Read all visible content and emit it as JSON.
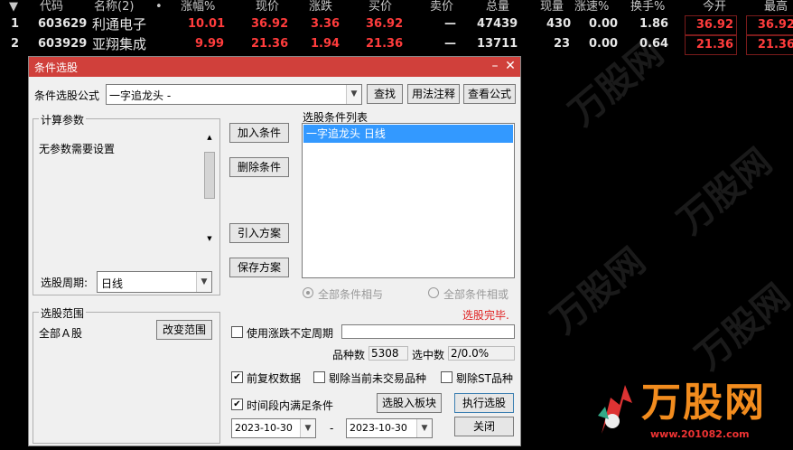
{
  "table": {
    "headers": [
      "代码",
      "名称(2)",
      "•",
      "涨幅%",
      "现价",
      "涨跌",
      "买价",
      "卖价",
      "总量",
      "现量",
      "涨速%",
      "换手%",
      "今开",
      "最高"
    ],
    "rows": [
      {
        "idx": "1",
        "code": "603629",
        "name": "利通电子",
        "change_pct": "10.01",
        "price": "36.92",
        "change": "3.36",
        "bid": "36.92",
        "ask": "—",
        "volume": "47439",
        "cur_vol": "430",
        "speed": "0.00",
        "turnover": "1.86",
        "open": "36.92",
        "high": "36.92"
      },
      {
        "idx": "2",
        "code": "603929",
        "name": "亚翔集成",
        "change_pct": "9.99",
        "price": "21.36",
        "change": "1.94",
        "bid": "21.36",
        "ask": "—",
        "volume": "13711",
        "cur_vol": "23",
        "speed": "0.00",
        "turnover": "0.64",
        "open": "21.36",
        "high": "21.36"
      }
    ]
  },
  "dialog": {
    "title": "条件选股",
    "formula_label": "条件选股公式",
    "formula_value": "一字追龙头  -",
    "btn_find": "查找",
    "btn_usage": "用法注释",
    "btn_view": "查看公式",
    "params_title": "计算参数",
    "params_text": "无参数需要设置",
    "period_label": "选股周期:",
    "period_value": "日线",
    "range_title": "选股范围",
    "range_text": "全部Ａ股",
    "btn_change_range": "改变范围",
    "btn_add": "加入条件",
    "btn_delete": "删除条件",
    "btn_import": "引入方案",
    "btn_save": "保存方案",
    "list_title": "选股条件列表",
    "list_items": [
      "一字追龙头  日线"
    ],
    "radio_and": "全部条件相与",
    "radio_or": "全部条件相或",
    "status": "选股完毕.",
    "chk_uncertain": "使用涨跌不定周期",
    "count_label": "品种数",
    "count_value": "5308",
    "selected_label": "选中数",
    "selected_value": "2/0.0%",
    "chk_restore": "前复权数据",
    "chk_exclude_untraded": "剔除当前未交易品种",
    "chk_exclude_st": "剔除ST品种",
    "chk_timerange": "时间段内满足条件",
    "btn_to_block": "选股入板块",
    "btn_execute": "执行选股",
    "date_from": "2023-10-30",
    "date_sep": "-",
    "date_to": "2023-10-30",
    "btn_close": "关闭"
  },
  "logo": {
    "text": "万股网",
    "url": "www.201082.com"
  },
  "colors": {
    "accent_red": "#d0403b",
    "price_red": "#ff3c3c",
    "status_red": "#e02020",
    "selected_blue": "#3399ff"
  }
}
